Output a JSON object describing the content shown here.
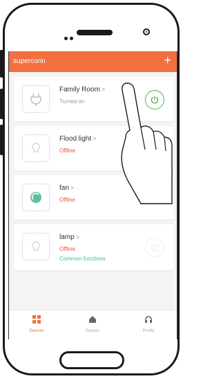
{
  "app": {
    "title": "superconn",
    "add_icon": "plus-icon"
  },
  "devices": [
    {
      "name": "Family Room",
      "status": "Turned on",
      "status_type": "on",
      "icon": "plug-icon",
      "power": "on"
    },
    {
      "name": "Flood light",
      "status": "Offline",
      "status_type": "offline",
      "icon": "bulb-icon"
    },
    {
      "name": "fan",
      "status": "Offline",
      "status_type": "offline",
      "icon": "fan-icon"
    },
    {
      "name": "lamp",
      "status": "Offline",
      "status_type": "offline",
      "extra": "Common functions",
      "icon": "bulb-icon",
      "power": "faded"
    }
  ],
  "tabs": [
    {
      "label": "Devices",
      "icon": "grid-icon",
      "active": true
    },
    {
      "label": "Scenes",
      "icon": "house-icon",
      "active": false
    },
    {
      "label": "Profile",
      "icon": "headphones-icon",
      "active": false
    }
  ],
  "colors": {
    "accent": "#f26f3f",
    "power_on": "#4caf50",
    "offline": "#e8582e",
    "extra": "#3fbf8a"
  }
}
